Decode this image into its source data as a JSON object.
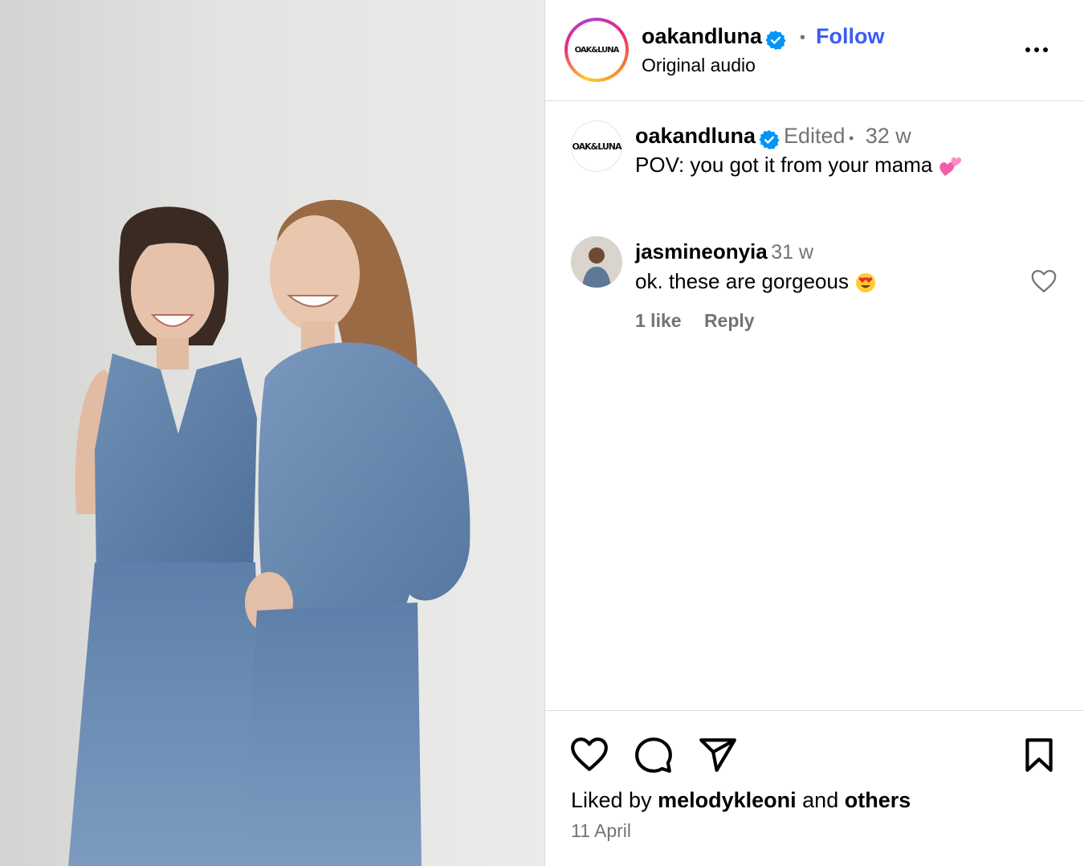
{
  "post": {
    "username": "oakandluna",
    "follow_label": "Follow",
    "separator": "•",
    "audio_label": "Original audio",
    "logo_text": "OAK&LUNA",
    "more_icon": "more-horizontal-icon"
  },
  "caption": {
    "username": "oakandluna",
    "edited": "Edited",
    "separator": "•",
    "time": "32 w",
    "text": "POV: you got it from your mama",
    "emoji_icon": "two-hearts-emoji"
  },
  "comments": [
    {
      "username": "jasmineonyia",
      "time": "31 w",
      "text": "ok. these are gorgeous",
      "emoji_icon": "heart-eyes-emoji",
      "likes": "1 like",
      "reply": "Reply"
    }
  ],
  "footer": {
    "liked_prefix": "Liked by",
    "liked_user": "melodykleoni",
    "liked_and": "and",
    "liked_others": "others",
    "date": "11 April"
  },
  "colors": {
    "accent": "#3b5bf6",
    "verified": "#0095f6",
    "muted": "#737373",
    "border": "#dbdbdb"
  }
}
